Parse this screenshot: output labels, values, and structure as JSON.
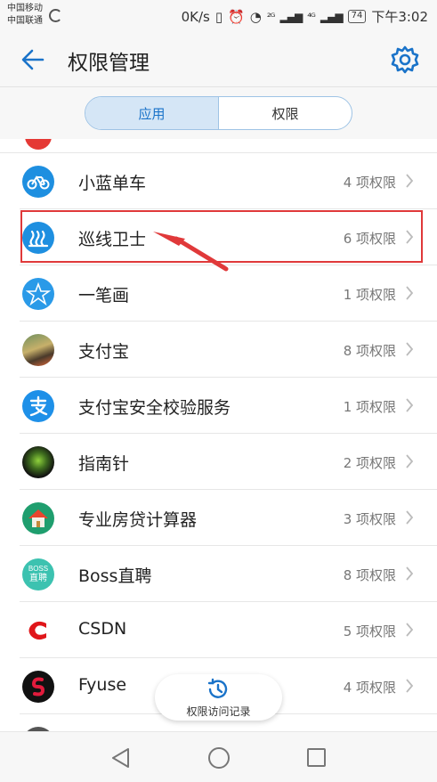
{
  "status_bar": {
    "carrier_1": "中国移动",
    "carrier_2": "中国联通",
    "speed": "0K/s",
    "network_1": "²ᴳ",
    "network_2": "⁴ᴳ",
    "battery": "74",
    "time": "下午3:02"
  },
  "header": {
    "title": "权限管理",
    "back_icon": "arrow-left",
    "settings_icon": "gear"
  },
  "tabs": [
    {
      "label": "应用",
      "active": true
    },
    {
      "label": "权限",
      "active": false
    }
  ],
  "apps": [
    {
      "name": "小蓝单车",
      "permissions": "4 项权限",
      "icon": "bike-icon"
    },
    {
      "name": "巡线卫士",
      "permissions": "6 项权限",
      "icon": "xunxian-icon"
    },
    {
      "name": "一笔画",
      "permissions": "1 项权限",
      "icon": "star-icon"
    },
    {
      "name": "支付宝",
      "permissions": "8 项权限",
      "icon": "photo-icon"
    },
    {
      "name": "支付宝安全校验服务",
      "permissions": "1 项权限",
      "icon": "alipay-icon"
    },
    {
      "name": "指南针",
      "permissions": "2 项权限",
      "icon": "compass-icon"
    },
    {
      "name": "专业房贷计算器",
      "permissions": "3 项权限",
      "icon": "house-icon"
    },
    {
      "name": "Boss直聘",
      "permissions": "8 项权限",
      "icon": "boss-icon",
      "icon_text_top": "BOSS",
      "icon_text_bottom": "直聘"
    },
    {
      "name": "CSDN",
      "permissions": "5 项权限",
      "icon": "csdn-icon"
    },
    {
      "name": "Fyuse",
      "permissions": "4 项权限",
      "icon": "fyuse-icon"
    }
  ],
  "fab": {
    "label": "权限访问记录",
    "icon": "history-icon"
  },
  "colors": {
    "accent": "#1a73c9",
    "highlight": "#e0393a",
    "app_blue": "#1e8fe0"
  }
}
